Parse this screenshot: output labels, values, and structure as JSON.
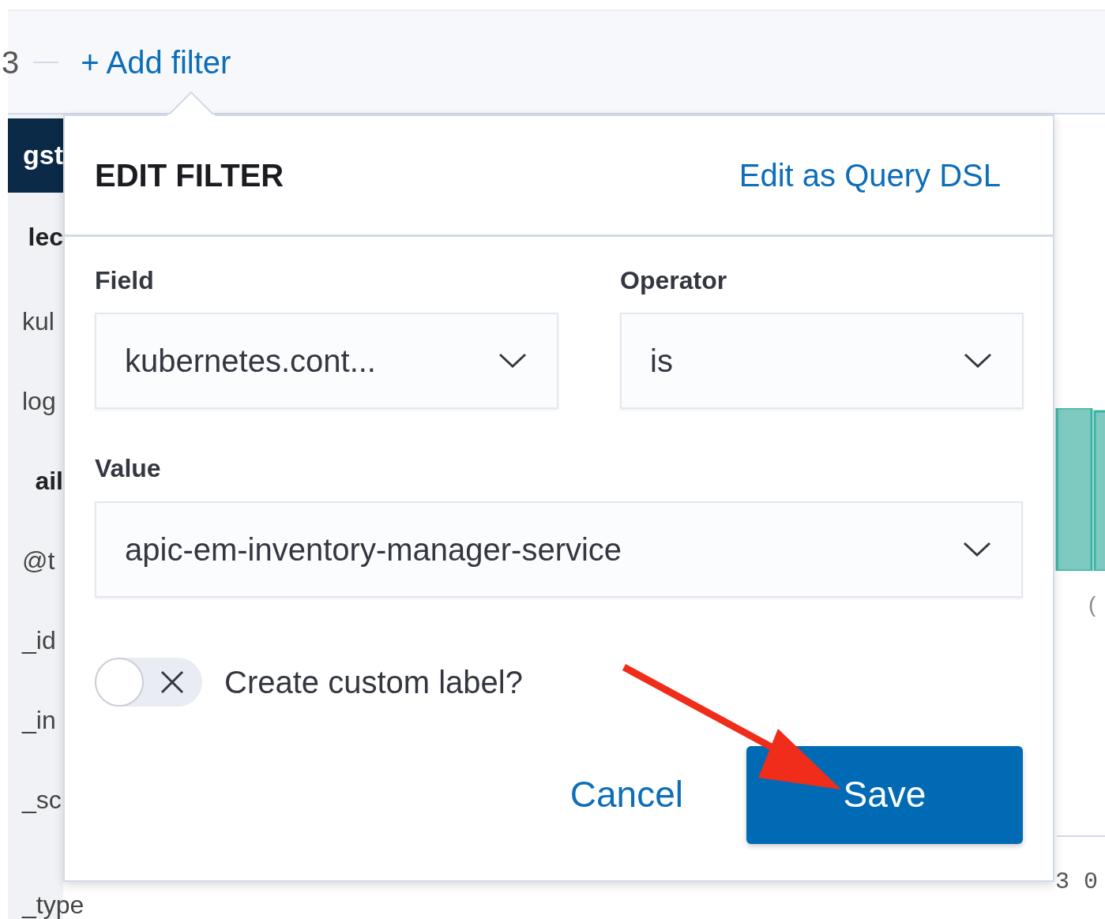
{
  "query_bar": {
    "fragment": "3",
    "add_filter": "+ Add filter"
  },
  "sidebar": {
    "index_pattern": "gst",
    "items": [
      {
        "kind": "heading",
        "text": "lec"
      },
      {
        "kind": "field",
        "text": "kul"
      },
      {
        "kind": "field",
        "text": "log"
      },
      {
        "kind": "heading",
        "text": "ail"
      },
      {
        "kind": "field",
        "text": "@t"
      },
      {
        "kind": "field",
        "text": "_id"
      },
      {
        "kind": "field",
        "text": "_in"
      },
      {
        "kind": "field",
        "text": "_sc"
      },
      {
        "kind": "field",
        "text": "_type"
      }
    ]
  },
  "chart": {
    "label_fragment": "(",
    "axis_fragment": "3 0"
  },
  "edit_filter": {
    "title": "EDIT FILTER",
    "query_dsl_link": "Edit as Query DSL",
    "field": {
      "label": "Field",
      "value": "kubernetes.cont..."
    },
    "operator": {
      "label": "Operator",
      "value": "is"
    },
    "value": {
      "label": "Value",
      "value": "apic-em-inventory-manager-service"
    },
    "custom_label": {
      "label": "Create custom label?",
      "on": false
    },
    "buttons": {
      "cancel": "Cancel",
      "save": "Save"
    }
  }
}
